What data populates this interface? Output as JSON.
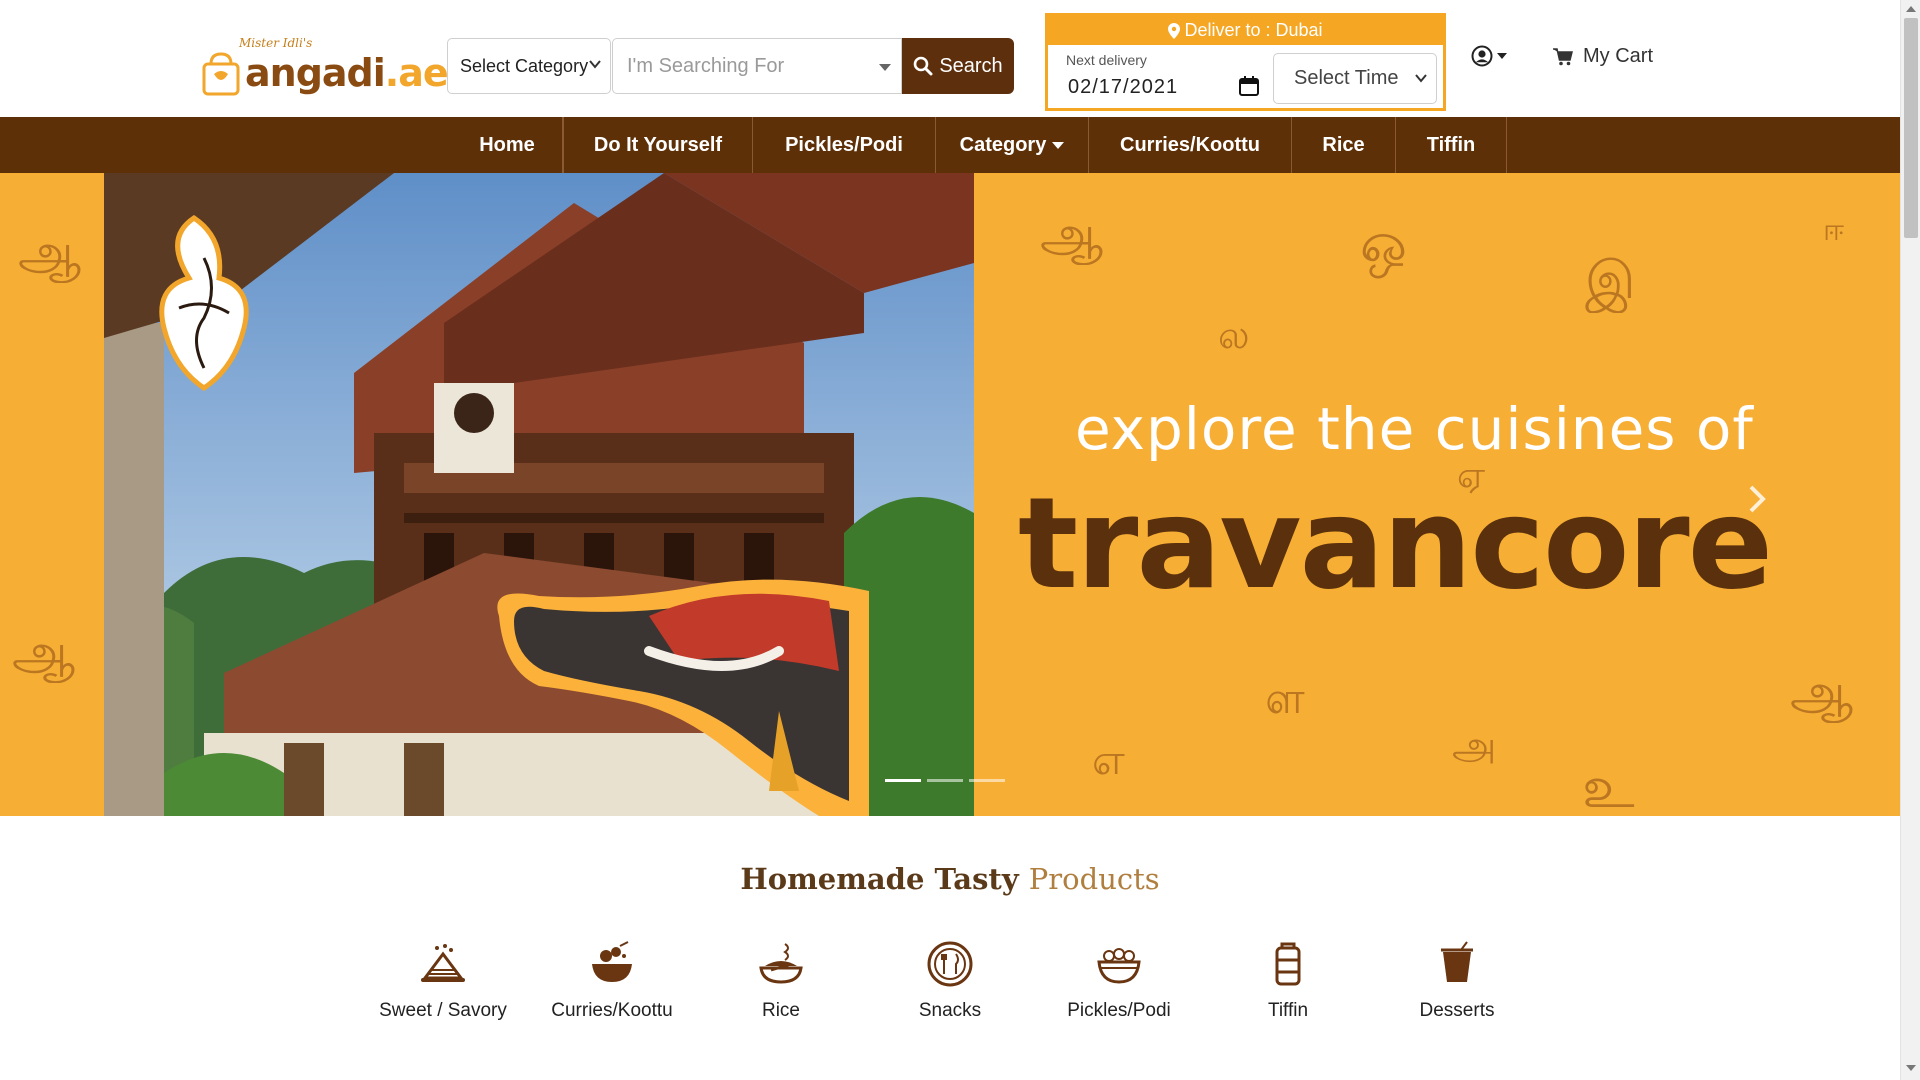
{
  "brand": {
    "tagline": "Mister Idli's",
    "name_main": "angadi",
    "name_suffix": ".ae"
  },
  "search": {
    "category_label": "Select Category",
    "placeholder": "I'm Searching For",
    "button_label": "Search"
  },
  "delivery": {
    "header": "Deliver to : Dubai",
    "next_label": "Next delivery",
    "date": "02/17/2021",
    "time_label": "Select Time"
  },
  "account": {
    "cart_label": "My Cart"
  },
  "nav": {
    "items": [
      {
        "label": "Home"
      },
      {
        "label": "Do It Yourself"
      },
      {
        "label": "Pickles/Podi"
      },
      {
        "label": "Category"
      },
      {
        "label": "Curries/Koottu"
      },
      {
        "label": "Rice"
      },
      {
        "label": "Tiffin"
      }
    ]
  },
  "hero": {
    "line1": "explore the cuisines of",
    "line2": "travancore",
    "slide_count": 3,
    "active_slide": 1,
    "deco_letters": [
      "ஆ",
      "ஒ",
      "இ",
      "ல",
      "ஏ",
      "ள",
      "ஆ",
      "அ",
      "எ",
      "உ",
      "ஆ",
      "ஆ",
      "ஈ"
    ]
  },
  "products": {
    "title_main": "Homemade Tasty",
    "title_accent": "Products",
    "categories": [
      {
        "label": "Sweet / Savory",
        "icon": "sweet-savory-icon"
      },
      {
        "label": "Curries/Koottu",
        "icon": "curry-bowl-icon"
      },
      {
        "label": "Rice",
        "icon": "rice-icon"
      },
      {
        "label": "Snacks",
        "icon": "snacks-plate-icon"
      },
      {
        "label": "Pickles/Podi",
        "icon": "pickles-bowl-icon"
      },
      {
        "label": "Tiffin",
        "icon": "tiffin-box-icon"
      },
      {
        "label": "Desserts",
        "icon": "dessert-cup-icon"
      }
    ]
  },
  "colors": {
    "brand_brown": "#5e3008",
    "accent_orange": "#f5a623",
    "hero_orange": "#f7ae34",
    "icon_brown": "#6a3612"
  }
}
